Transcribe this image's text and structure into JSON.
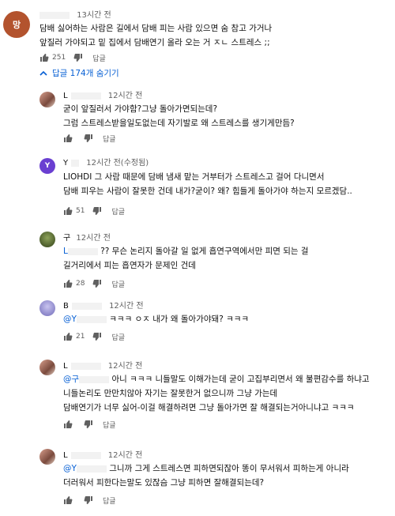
{
  "top_comment": {
    "avatar_letter": "망",
    "time": "13시간 전",
    "lines": [
      "담배 싫어하는 사람은 길에서 담배 피는 사람 있으면 숨 참고 가거나",
      "앞질러 가야되고 밑 집에서 담배연기 올라 오는 거 ㅈㄴ 스트레스 ;;"
    ],
    "likes": "251",
    "reply_label": "답글"
  },
  "replies_toggle": {
    "label": "답글 174개 숨기기"
  },
  "replies": [
    {
      "name": "L",
      "time": "12시간 전",
      "lines": [
        "굳이 앞질러서 가야함?그냥 돌아가면되는데?",
        "그럼 스트레스받을일도없는데 자기발로 왜 스트레스를 생기게만듬?"
      ],
      "likes": "",
      "reply_label": "답글"
    },
    {
      "name": "Y",
      "avatar_letter": "Y",
      "time": "12시간 전(수정됨)",
      "lines": [
        "LIOHDI 그 사람 때문에 담배 냄새 맡는 거부터가 스트레스고  걸어 다니면서",
        "담배 피우는 사람이  잘못한 건데 내가?굳이? 왜? 힘들게 돌아가야 하는지 모르겠담.."
      ],
      "likes": "51",
      "reply_label": "답글"
    },
    {
      "name": "구",
      "time": "12시간 전",
      "mention": "L",
      "lines": [
        " ?? 무슨 논리지 돌아갈 일 없게 흡연구역에서만 피면 되는 걸",
        "길거리에서 피는 흡연자가 문제인 건데"
      ],
      "likes": "28",
      "reply_label": "답글"
    },
    {
      "name": "B",
      "time": "12시간 전",
      "mention": "@Y",
      "lines": [
        "  ㅋㅋㅋ ㅇㅈ 내가 왜 돌아가야돼? ㅋㅋㅋ"
      ],
      "likes": "21",
      "reply_label": "답글"
    },
    {
      "name": "L",
      "time": "12시간 전",
      "mention": "@구",
      "lines": [
        "  아니 ㅋㅋㅋ 니들말도 이해가는데 굳이 고집부리면서 왜 불편감수를 하냐고",
        "니들논리도 만만치않아 자기는 잘못한거 없으니까 그냥 가는데",
        "담배연기가 너무 싫어-이걸 해결하려면  그냥 돌아가면 잘 해결되는거아니냐고 ㅋㅋㅋ"
      ],
      "likes": "",
      "reply_label": "답글"
    },
    {
      "name": "L",
      "time": "12시간 전",
      "mention": "@Y",
      "lines": [
        "  그니까 그게 스트레스면 피하면되잖아 똥이 무서워서 피하는게 아니라",
        "더러워서 피한다는말도 있잖슴 그냥 피하면 잘해결되는데?"
      ],
      "likes": "",
      "reply_label": "답글"
    }
  ],
  "colors": {
    "link": "#065fd4",
    "meta": "#606060",
    "top_avatar": "#b3532e",
    "y_avatar": "#6a3fd1"
  }
}
